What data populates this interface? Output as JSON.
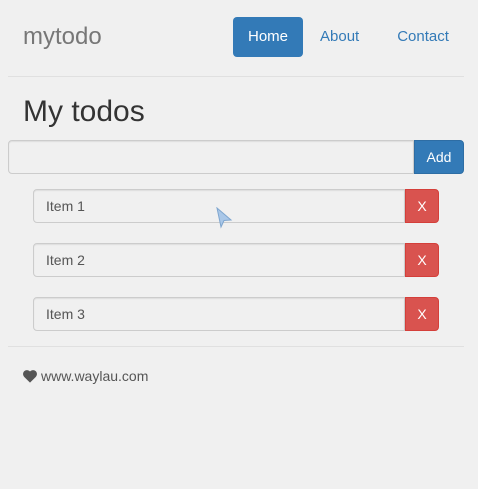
{
  "header": {
    "brand": "mytodo",
    "nav": [
      {
        "label": "Home",
        "active": true
      },
      {
        "label": "About",
        "active": false
      },
      {
        "label": "Contact",
        "active": false
      }
    ]
  },
  "main": {
    "title": "My todos",
    "add_input": {
      "value": "",
      "placeholder": ""
    },
    "add_button": "Add",
    "todos": [
      {
        "text": "Item 1",
        "delete_label": "X"
      },
      {
        "text": "Item 2",
        "delete_label": "X"
      },
      {
        "text": "Item 3",
        "delete_label": "X"
      }
    ]
  },
  "footer": {
    "icon": "heart-icon",
    "text": "www.waylau.com"
  },
  "colors": {
    "primary": "#337ab7",
    "danger": "#d9534f",
    "background": "#f0f0f0"
  }
}
